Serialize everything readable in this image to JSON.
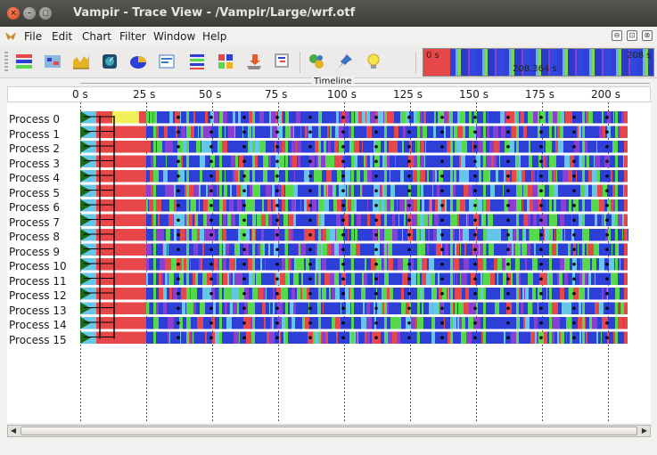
{
  "window": {
    "title": "Vampir - Trace View - /Vampir/Large/wrf.otf",
    "close_glyph": "×",
    "min_glyph": "–",
    "max_glyph": "◻"
  },
  "menu": {
    "items": [
      "File",
      "Edit",
      "Chart",
      "Filter",
      "Window",
      "Help"
    ],
    "mdi_buttons": [
      "⊖",
      "⊡",
      "⊗"
    ]
  },
  "toolbar": {
    "icons": [
      "master-timeline-icon",
      "process-timeline-icon",
      "counter-timeline-icon",
      "performance-radar-icon",
      "function-summary-icon",
      "message-summary-icon",
      "process-summary-icon",
      "communication-matrix-icon",
      "io-summary-icon",
      "call-tree-icon",
      "function-filter-icon",
      "pin-icon",
      "hint-icon"
    ]
  },
  "overview": {
    "start_label": "0 s",
    "mid_label": "208.364 s",
    "end_label": "208 s"
  },
  "timeline": {
    "caption": "Timeline",
    "ticks": [
      "0 s",
      "25 s",
      "50 s",
      "75 s",
      "100 s",
      "125 s",
      "150 s",
      "175 s",
      "200 s"
    ]
  },
  "processes": [
    "Process 0",
    "Process 1",
    "Process 2",
    "Process 3",
    "Process 4",
    "Process 5",
    "Process 6",
    "Process 7",
    "Process 8",
    "Process 9",
    "Process 10",
    "Process 11",
    "Process 12",
    "Process 13",
    "Process 14",
    "Process 15"
  ],
  "colors": {
    "mpi_red": "#e8474a",
    "compute_blue": "#2e3fd8",
    "light_blue": "#66c6e8",
    "green": "#55d84a",
    "purple": "#8a3fd0",
    "yellow": "#f1ef5a",
    "message_line": "#000000"
  }
}
